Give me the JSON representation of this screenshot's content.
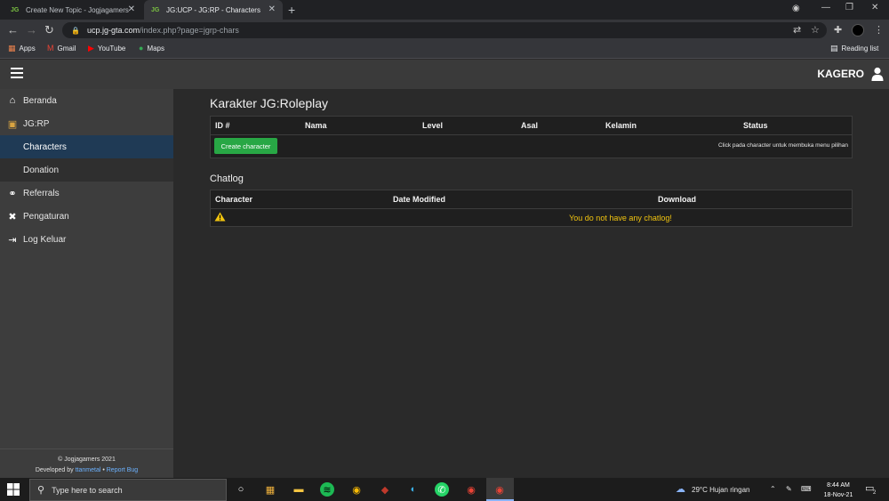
{
  "browser": {
    "tabs": [
      {
        "favicon": "JG",
        "title": "Create New Topic - Jogjagamers"
      },
      {
        "favicon": "JG",
        "title": "JG:UCP - JG:RP - Characters"
      }
    ],
    "new_tab_symbol": "+",
    "address": {
      "host": "ucp.jg-gta.com",
      "path": "/index.php?page=jgrp-chars"
    },
    "bookmarks": [
      "Apps",
      "Gmail",
      "YouTube",
      "Maps"
    ],
    "reading_list": "Reading list"
  },
  "header": {
    "username": "KAGERO"
  },
  "sidebar": {
    "items": [
      {
        "icon": "home-icon",
        "label": "Beranda"
      },
      {
        "icon": "game-icon",
        "label": "JG:RP"
      },
      {
        "icon": "",
        "label": "Characters"
      },
      {
        "icon": "",
        "label": "Donation"
      },
      {
        "icon": "handshake-icon",
        "label": "Referrals"
      },
      {
        "icon": "tools-icon",
        "label": "Pengaturan"
      },
      {
        "icon": "logout-icon",
        "label": "Log Keluar"
      }
    ],
    "footer": {
      "copyright": "© Jogjagamers 2021",
      "developed_by": "Developed by",
      "developer": "ttanmetal",
      "separator": "•",
      "report_bug": "Report Bug"
    }
  },
  "characters": {
    "title": "Karakter JG:Roleplay",
    "columns": [
      "ID #",
      "Nama",
      "Level",
      "Asal",
      "Kelamin",
      "Status"
    ],
    "create_button": "Create character",
    "hint": "Click pada character untuk membuka menu pilihan"
  },
  "chatlog": {
    "title": "Chatlog",
    "columns": [
      "Character",
      "Date Modified",
      "Download"
    ],
    "empty_message": "You do not have any chatlog!"
  },
  "taskbar": {
    "search_placeholder": "Type here to search",
    "weather": "29°C  Hujan ringan",
    "time": "8:44 AM",
    "date": "18-Nov-21",
    "notification_count": "2"
  },
  "colors": {
    "accent_green": "#28a745",
    "active_nav": "#1f3a55",
    "warning": "#f1c40f",
    "link": "#6cb2ff"
  }
}
